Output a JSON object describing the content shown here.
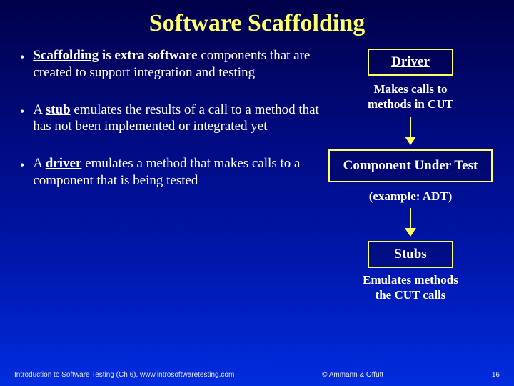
{
  "title": "Software Scaffolding",
  "bullets": [
    {
      "lead_u": "Scaffolding",
      "rest_b": " is extra software",
      "cont": "components that are created to support integration and testing"
    },
    {
      "pre": "A ",
      "lead_u": "stub",
      "rest_b": " emulates the results of a call to a method that has not been implemented or integrated yet"
    },
    {
      "pre": "A ",
      "lead_u": "driver",
      "rest_b": " emulates a method that makes calls to a component that is being tested"
    }
  ],
  "diagram": {
    "driver": "Driver",
    "driver_caption_l1": "Makes calls to",
    "driver_caption_l2": "methods in CUT",
    "cut": "Component Under Test",
    "example": "(example: ADT)",
    "stubs": "Stubs",
    "stubs_caption_l1": "Emulates methods",
    "stubs_caption_l2": "the CUT calls"
  },
  "footer": {
    "left": "Introduction to Software Testing (Ch 6), www.introsoftwaretesting.com",
    "center": "© Ammann & Offutt",
    "right": "16"
  }
}
